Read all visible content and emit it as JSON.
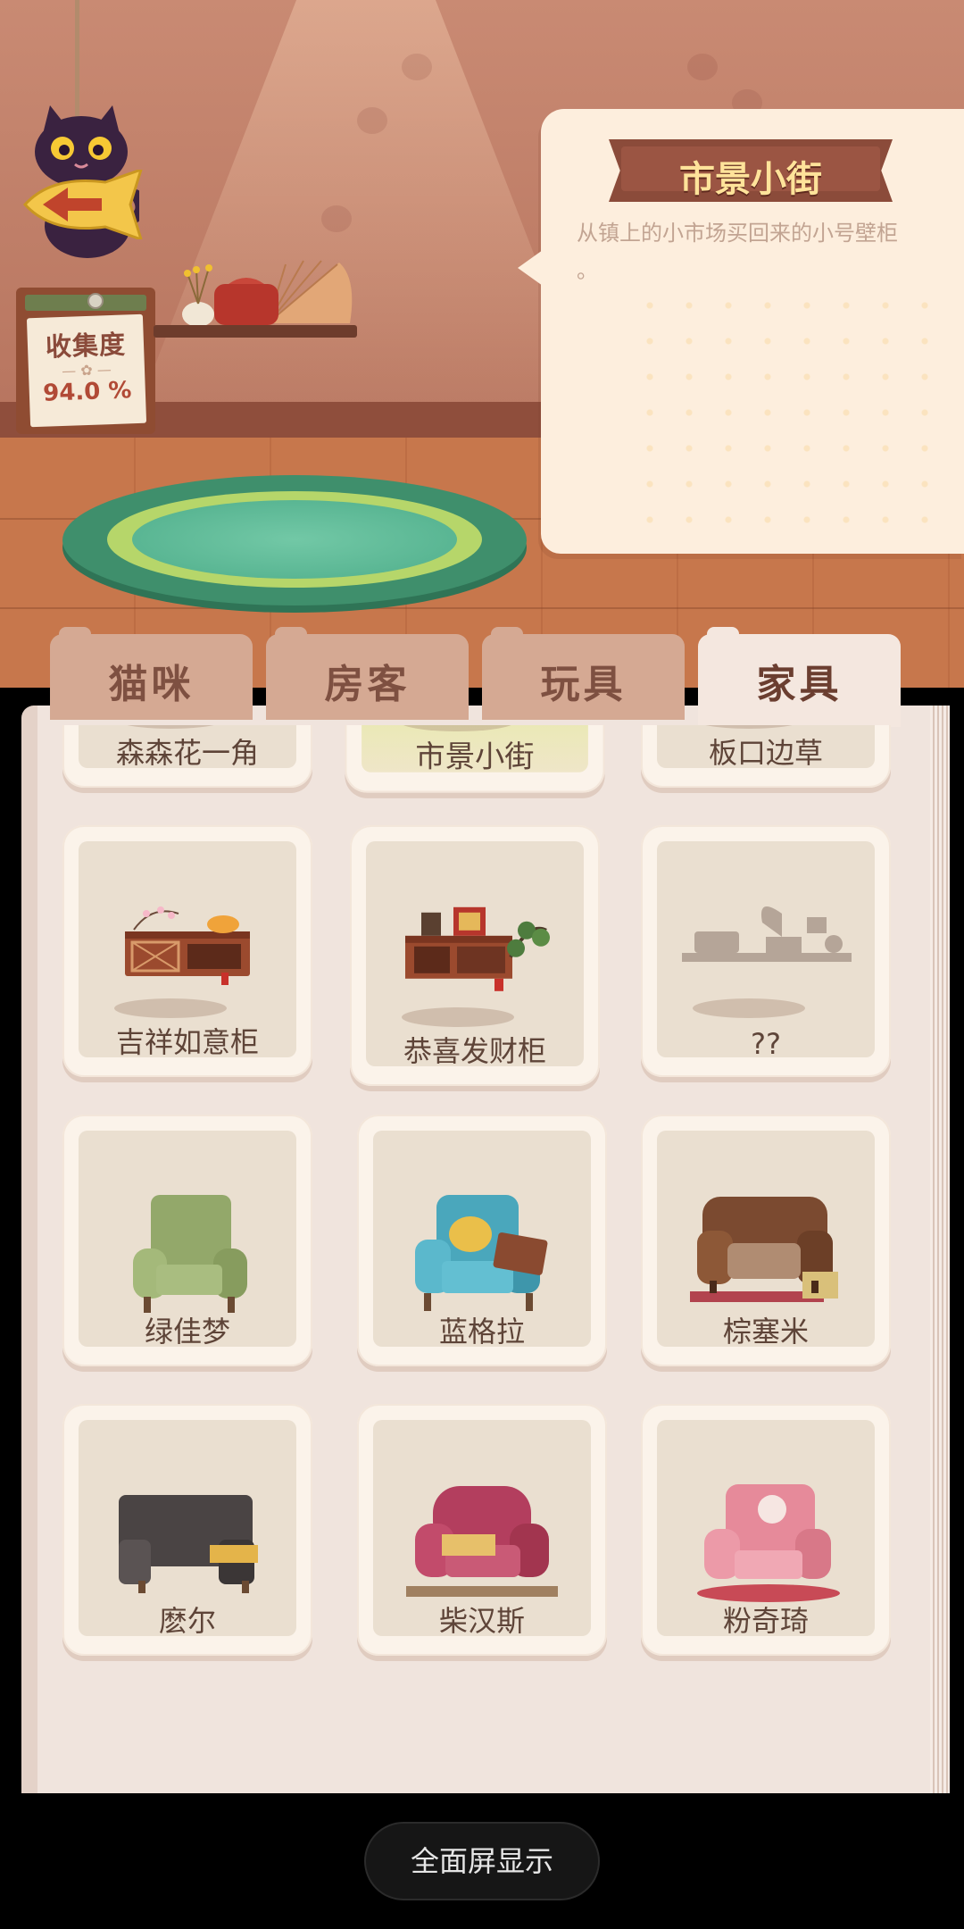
{
  "room": {
    "collection": {
      "title": "收集度",
      "value": "94.0 %"
    }
  },
  "info": {
    "title": "市景小街",
    "description": "从镇上的小市场买回来的小号壁柜",
    "description_tail": "。"
  },
  "tabs": [
    {
      "label": "猫咪",
      "active": false
    },
    {
      "label": "房客",
      "active": false
    },
    {
      "label": "玩具",
      "active": false
    },
    {
      "label": "家具",
      "active": true
    }
  ],
  "items": [
    {
      "label": "森森花一角",
      "icon": "shelf-flowers-icon"
    },
    {
      "label": "市景小街",
      "icon": "shelf-market-icon",
      "selected": true
    },
    {
      "label": "板口边草",
      "icon": "shelf-plant-icon"
    },
    {
      "label": "吉祥如意柜",
      "icon": "lucky-cabinet-icon"
    },
    {
      "label": "恭喜发财柜",
      "icon": "fortune-cabinet-icon"
    },
    {
      "label": "??",
      "icon": "locked-gramophone-cabinet-icon",
      "locked": true
    },
    {
      "label": "绿佳梦",
      "icon": "green-armchair-icon"
    },
    {
      "label": "蓝格拉",
      "icon": "blue-armchair-icon"
    },
    {
      "label": "棕塞米",
      "icon": "brown-armchair-icon"
    },
    {
      "label": "麽尔",
      "icon": "black-armchair-icon"
    },
    {
      "label": "柴汉斯",
      "icon": "red-armchair-icon"
    },
    {
      "label": "粉奇琦",
      "icon": "pink-armchair-icon"
    }
  ],
  "bottom": {
    "fullscreen_label": "全面屏显示"
  },
  "colors": {
    "wall": "#c98a73",
    "floor": "#c67a4f",
    "tab": "#d5a993",
    "tab_active": "#f4e7df",
    "banner": "#8b4b3a",
    "banner_text": "#ffe39a",
    "selected_card": "#cfe07a"
  }
}
